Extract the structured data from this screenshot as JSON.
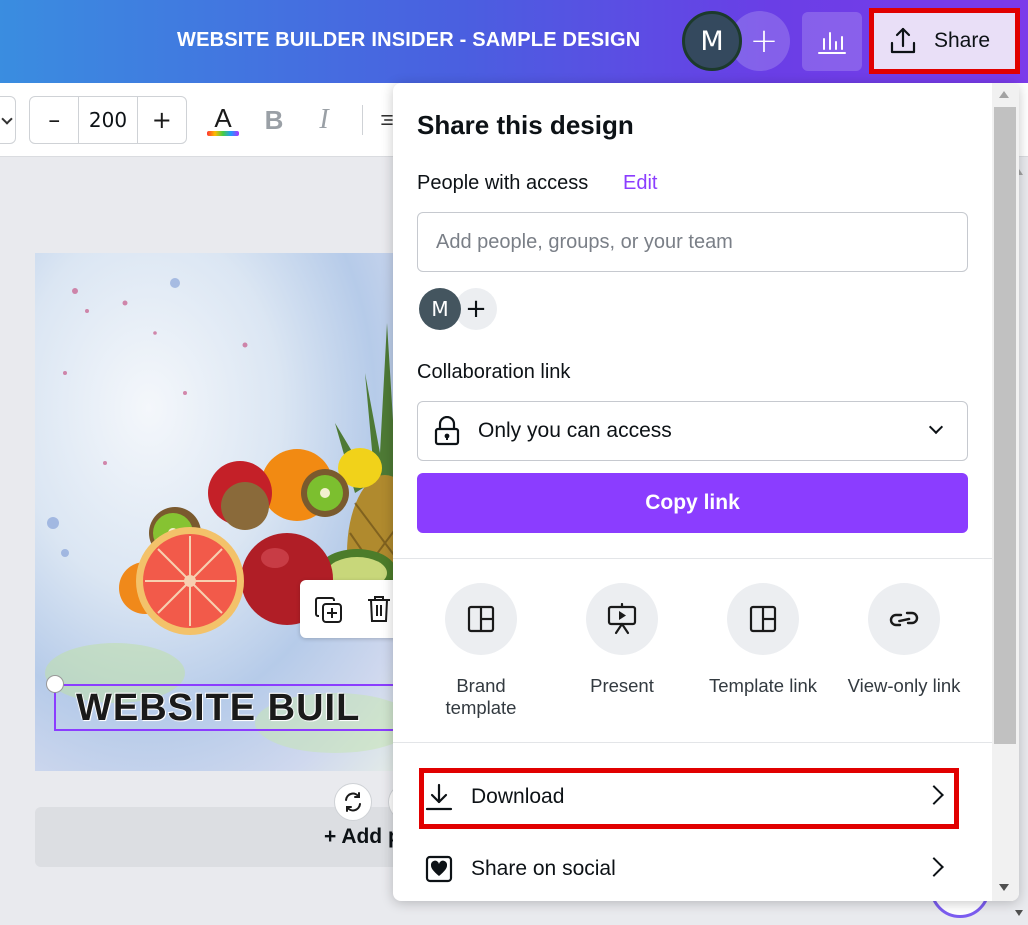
{
  "header": {
    "doc_title": "WEBSITE BUILDER INSIDER - SAMPLE DESIGN",
    "avatar_initial": "M",
    "add_glyph": "+",
    "insights_icon": "bar-chart-icon",
    "share_label": "Share",
    "share_icon": "upload-icon"
  },
  "toolbar": {
    "font_size": "200",
    "decrease": "–",
    "increase": "+",
    "text_color_glyph": "A",
    "bold_glyph": "B",
    "italic_glyph": "I"
  },
  "canvas": {
    "design_text": "WEBSITE BUIL",
    "add_page_label": "+ Add p"
  },
  "share_panel": {
    "title": "Share this design",
    "people_label": "People with access",
    "edit_label": "Edit",
    "people_placeholder": "Add people, groups, or your team",
    "member_initial": "M",
    "member_add": "+",
    "collab_label": "Collaboration link",
    "access_value": "Only you can access",
    "copy_link_label": "Copy link",
    "options": [
      {
        "label": "Brand template",
        "icon": "template-icon"
      },
      {
        "label": "Present",
        "icon": "present-icon"
      },
      {
        "label": "Template link",
        "icon": "template-link-icon"
      },
      {
        "label": "View-only link",
        "icon": "link-icon"
      }
    ],
    "rows": [
      {
        "label": "Download",
        "icon": "download-icon"
      },
      {
        "label": "Share on social",
        "icon": "heart-icon"
      }
    ]
  },
  "colors": {
    "accent": "#8b3dff",
    "highlight": "#e10000",
    "header_start": "#3a8de0",
    "header_end": "#7b3bea"
  }
}
